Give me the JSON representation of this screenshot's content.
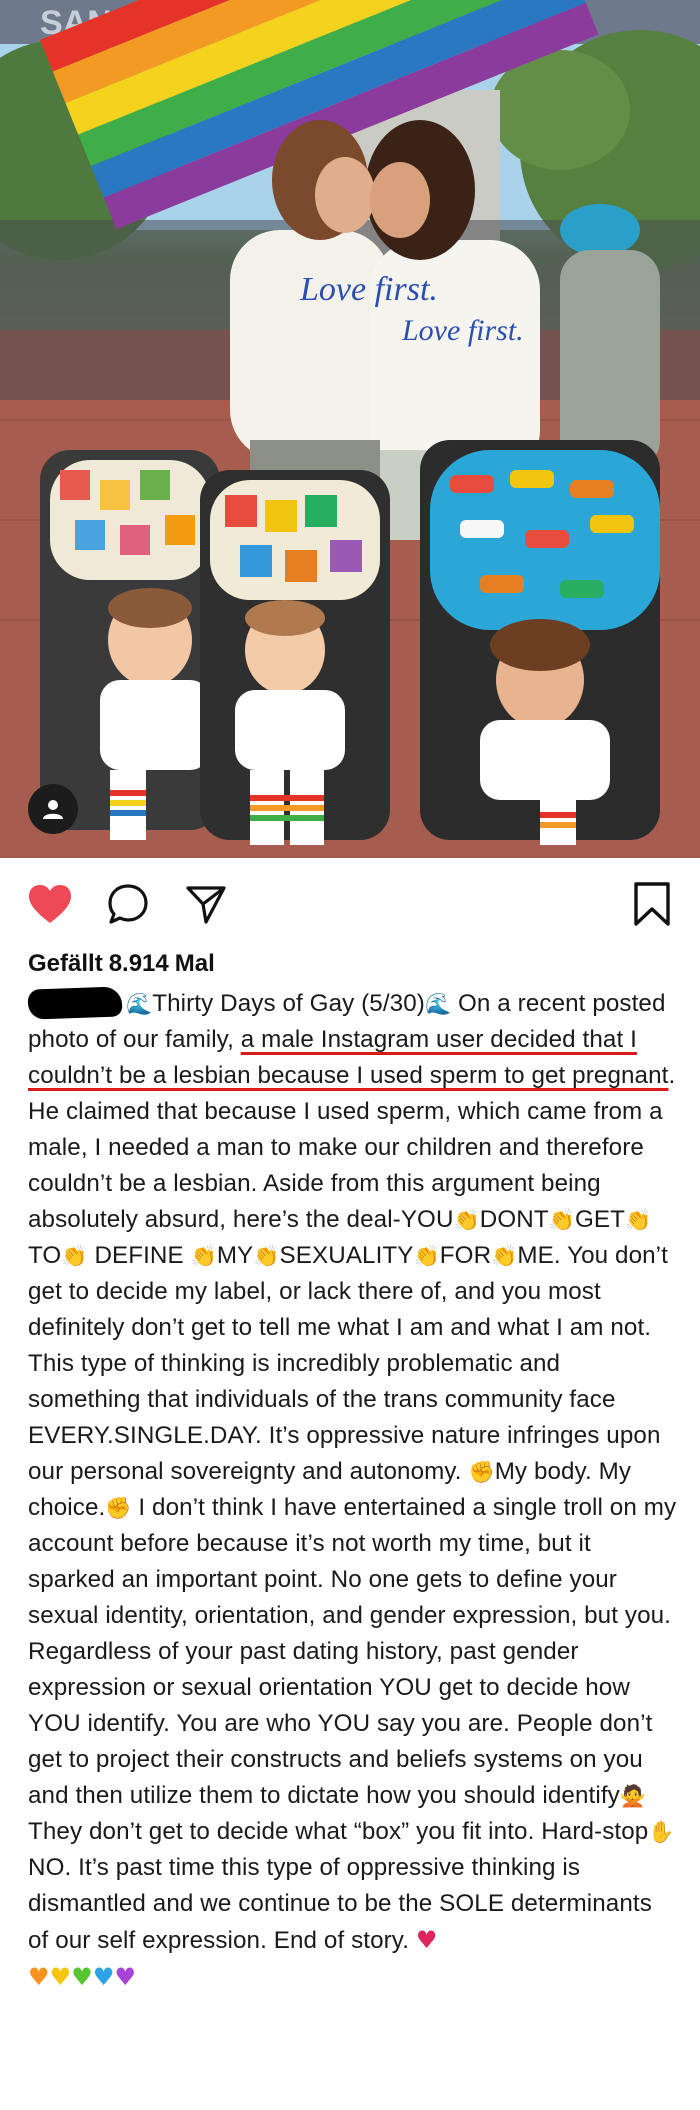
{
  "photo": {
    "banner_text": "SAN FRANCISCO PRIDE",
    "shirt_text_left": "Love first.",
    "shirt_text_right": "Love first."
  },
  "actions": {
    "like_icon": "heart-filled-icon",
    "comment_icon": "comment-icon",
    "share_icon": "send-icon",
    "save_icon": "bookmark-icon",
    "like_color": "#ed4956"
  },
  "likes": {
    "label": "Gefällt",
    "count": "8.914",
    "suffix": "Mal"
  },
  "caption": {
    "wave_emoji": "🌊",
    "p1": "Thirty Days of Gay (5/30)",
    "p2": "On a recent posted photo of our family, ",
    "underlined": "a male Instagram user decided that I couldn’t be a lesbian because I used sperm to get pregnant",
    "p3": ". He claimed that because I used sperm, which came from a male, I needed a man to make our children and therefore couldn’t be a lesbian. Aside from this argument being absolutely absurd, here’s the deal-YOU",
    "clap": "👏",
    "w_dont": "DONT",
    "w_get": "GET",
    "w_to": "TO",
    "w_define": "DEFINE",
    "w_my": "MY",
    "w_sexuality": "SEXUALITY",
    "w_for": "FOR",
    "w_me": "ME.",
    "p4": " You don’t get to decide my label, or lack there of, and you most definitely don’t get to tell me what I am and what I am not. This type of thinking is incredibly problematic and something that individuals of the trans community face EVERY.SINGLE.DAY. It’s oppressive nature infringes upon our personal sovereignty and autonomy. ",
    "fist": "✊",
    "p5": "My body. My choice.",
    "p6": " I don’t think I have entertained a single troll on my account before because it’s not worth my time, but it sparked an important point. No one gets to define your sexual identity, orientation, and gender expression, but you. Regardless of your past dating history, past gender expression or sexual orientation YOU get to decide how YOU identify. You are who YOU say you are. People don’t get to project their constructs and beliefs systems on you and then utilize them to dictate how you should identify",
    "woman_emoji": "🙅",
    "p7": "They don’t get to decide what “box” you fit into. Hard-stop",
    "hand_emoji": "✋",
    "p8": "NO. It’s past time this type of oppressive thinking is dismantled and we continue to be the SOLE determinants of our self expression. End of story. ",
    "heart": "♥"
  }
}
